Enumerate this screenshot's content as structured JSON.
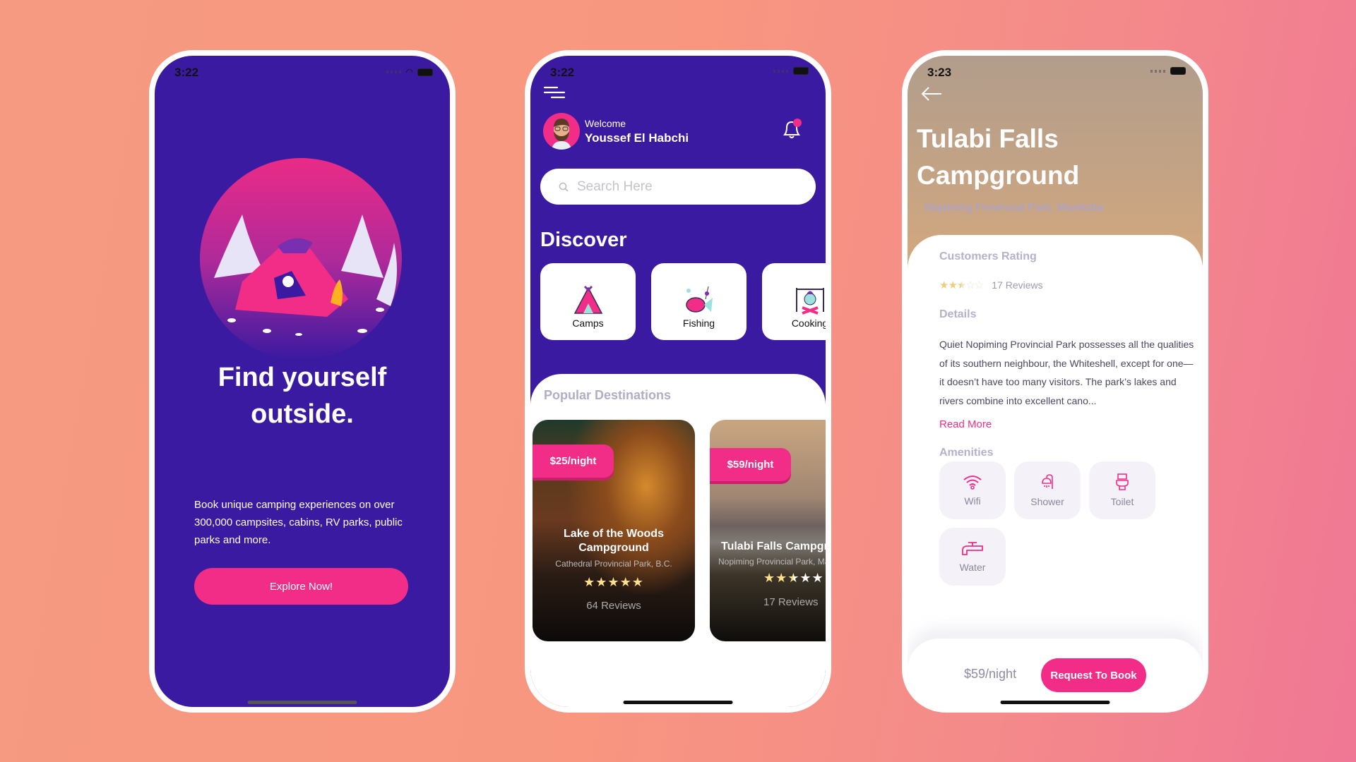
{
  "colors": {
    "primary": "#3a1aa0",
    "accent": "#f22d87"
  },
  "onboarding": {
    "status_time": "3:22",
    "title_line1": "Find yourself",
    "title_line2": "outside.",
    "description": "Book unique camping experiences on over 300,000 campsites, cabins, RV parks, public parks and more.",
    "cta_label": "Explore Now!"
  },
  "home": {
    "status_time": "3:22",
    "welcome": "Welcome",
    "user_name": "Youssef El Habchi",
    "search_placeholder": "Search Here",
    "discover_title": "Discover",
    "categories": [
      {
        "label": "Camps",
        "icon": "tent-icon"
      },
      {
        "label": "Fishing",
        "icon": "fish-icon"
      },
      {
        "label": "Cooking",
        "icon": "cooking-pot-icon"
      }
    ],
    "popular_title": "Popular Destinations",
    "destinations": [
      {
        "price": "$25/night",
        "name": "Lake of the Woods Campground",
        "location": "Cathedral Provincial Park, B.C.",
        "rating": 5,
        "stars": "★★★★★",
        "reviews": "64 Reviews"
      },
      {
        "price": "$59/night",
        "name": "Tulabi Falls Campground",
        "location": "Nopiming Provincial Park, Manitoba",
        "rating": 2.5,
        "stars": "★★★★★",
        "reviews": "17 Reviews"
      }
    ]
  },
  "detail": {
    "status_time": "3:23",
    "title_line1": "Tulabi Falls",
    "title_line2": "Campground",
    "location": "Nopiming Provincial Park, Manitoba",
    "rating_title": "Customers Rating",
    "rating": 2.5,
    "reviews": "17 Reviews",
    "details_title": "Details",
    "details_text": "Quiet Nopiming Provincial Park possesses all the qualities of its southern neighbour, the Whiteshell, except for one—it doesn’t have too many visitors. The park’s lakes and rivers combine into excellent cano...",
    "read_more": "Read More",
    "amenities_title": "Amenities",
    "amenities": [
      {
        "label": "Wifi",
        "icon": "wifi-icon"
      },
      {
        "label": "Shower",
        "icon": "shower-icon"
      },
      {
        "label": "Toilet",
        "icon": "toilet-icon"
      },
      {
        "label": "Water",
        "icon": "water-tap-icon"
      }
    ],
    "price": "$59/night",
    "book_label": "Request To Book"
  }
}
